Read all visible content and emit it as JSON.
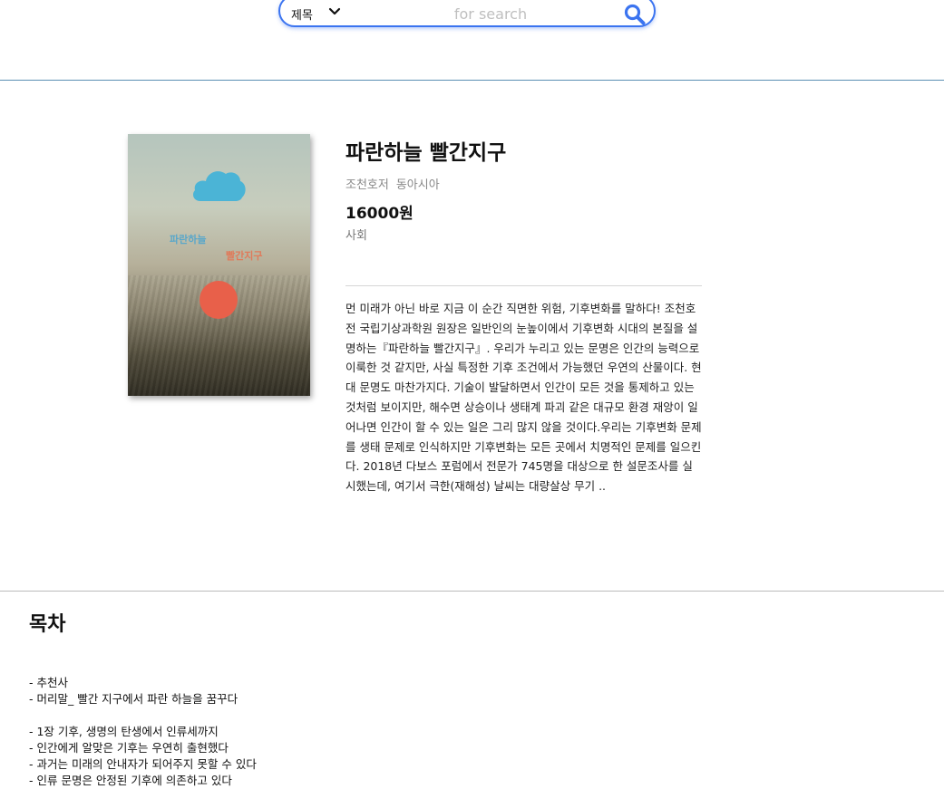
{
  "search": {
    "field_select": "제목",
    "placeholder": "for search",
    "icon": "search-icon"
  },
  "book": {
    "title": "파란하늘 빨간지구",
    "author": "조천호저",
    "publisher": "동아시아",
    "price": "16000원",
    "category": "사회",
    "cover": {
      "title_line1": "파란하늘",
      "title_line2": "빨간지구",
      "colors": {
        "cloud": "#4bb4d6",
        "sun": "#e8604a"
      }
    },
    "description": "먼 미래가 아닌 바로 지금 이 순간 직면한 위험, 기후변화를 말하다! 조천호 전 국립기상과학원 원장은 일반인의 눈높이에서 기후변화 시대의 본질을 설명하는『파란하늘 빨간지구』. 우리가 누리고 있는 문명은 인간의 능력으로 이룩한 것 같지만, 사실 특정한 기후 조건에서 가능했던 우연의 산물이다. 현대 문명도 마찬가지다. 기술이 발달하면서 인간이 모든 것을 통제하고 있는 것처럼 보이지만, 해수면 상승이나 생태계 파괴 같은 대규모 환경 재앙이 일어나면 인간이 할 수 있는 일은 그리 많지 않을 것이다.우리는 기후변화 문제를 생태 문제로 인식하지만 기후변화는 모든 곳에서 치명적인 문제를 일으킨다. 2018년 다보스 포럼에서 전문가 745명을 대상으로 한 설문조사를 실시했는데, 여기서 극한(재해성) 날씨는 대량살상 무기 .."
  },
  "toc": {
    "heading": "목차",
    "items": [
      "- 추천사",
      "- 머리말_ 빨간 지구에서 파란 하늘을 꿈꾸다",
      "",
      "- 1장 기후, 생명의 탄생에서 인류세까지",
      "- 인간에게 알맞은 기후는 우연히 출현했다",
      "- 과거는 미래의 안내자가 되어주지 못할 수 있다",
      "- 인류 문명은 안정된 기후에 의존하고 있다"
    ]
  },
  "colors": {
    "accent": "#3b74f0",
    "top_divider": "#5b8fb3"
  }
}
